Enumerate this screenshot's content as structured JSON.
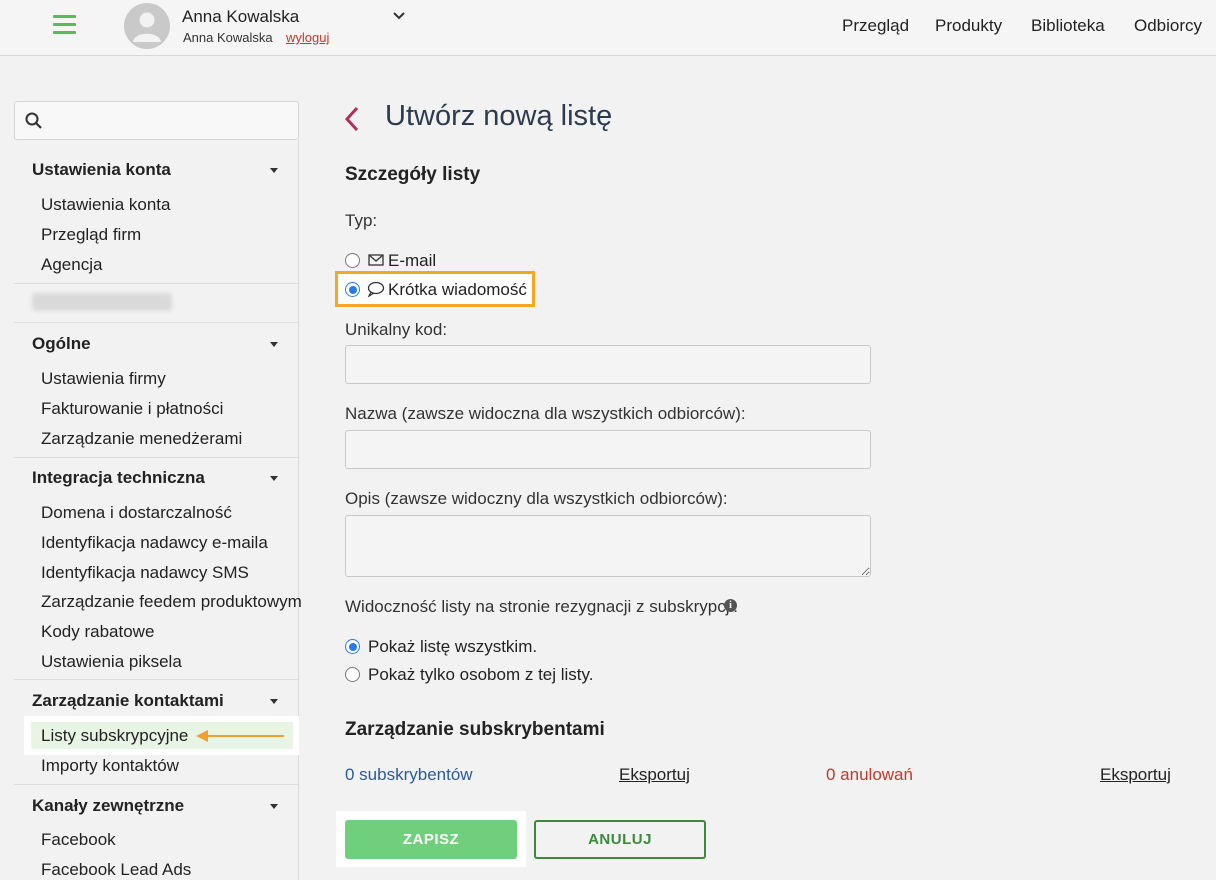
{
  "header": {
    "user_name": "Anna Kowalska",
    "user_sub": "Anna Kowalska",
    "logout": "wyloguj",
    "nav": [
      "Przegląd",
      "Produkty",
      "Biblioteka",
      "Odbiorcy"
    ]
  },
  "sidebar": {
    "search_placeholder": "",
    "sections": [
      {
        "title": "Ustawienia konta",
        "items": [
          "Ustawienia konta",
          "Przegląd firm",
          "Agencja"
        ]
      },
      {
        "title": "Ogólne",
        "items": [
          "Ustawienia firmy",
          "Fakturowanie i płatności",
          "Zarządzanie menedżerami"
        ]
      },
      {
        "title": "Integracja techniczna",
        "items": [
          "Domena i dostarczalność",
          "Identyfikacja nadawcy e-maila",
          "Identyfikacja nadawcy SMS",
          "Zarządzanie feedem produktowym",
          "Kody rabatowe",
          "Ustawienia piksela"
        ]
      },
      {
        "title": "Zarządzanie kontaktami",
        "items": [
          "Listy subskrypcyjne",
          "Importy kontaktów"
        ]
      },
      {
        "title": "Kanały zewnętrzne",
        "items": [
          "Facebook",
          "Facebook Lead Ads"
        ]
      }
    ],
    "active_item": "Listy subskrypcyjne"
  },
  "main": {
    "title": "Utwórz nową listę",
    "details_title": "Szczegóły listy",
    "type_label": "Typ:",
    "type_options": [
      {
        "label": "E-mail",
        "icon": "envelope-icon",
        "checked": false
      },
      {
        "label": "Krótka wiadomość",
        "icon": "speech-bubble-icon",
        "checked": true
      }
    ],
    "code_label": "Unikalny kod:",
    "code_value": "",
    "name_label": "Nazwa (zawsze widoczna dla wszystkich odbiorców):",
    "name_value": "",
    "desc_label": "Opis (zawsze widoczny dla wszystkich odbiorców):",
    "desc_value": "",
    "visibility_label": "Widoczność listy na stronie rezygnacji z subskrypcji:",
    "visibility_options": [
      {
        "label": "Pokaż listę wszystkim.",
        "checked": true
      },
      {
        "label": "Pokaż tylko osobom z tej listy.",
        "checked": false
      }
    ],
    "subs_title": "Zarządzanie subskrybentami",
    "subscribers": "0 subskrybentów",
    "export_1": "Eksportuj",
    "cancellations": "0 anulowań",
    "export_2": "Eksportuj",
    "save_label": "ZAPISZ",
    "cancel_label": "ANULUJ"
  },
  "colors": {
    "accent_green": "#6fcf7d",
    "highlight_orange": "#f5a623",
    "radio_blue": "#2b7be4",
    "link_blue": "#2a5a9a",
    "alert_red": "#c0392b"
  }
}
